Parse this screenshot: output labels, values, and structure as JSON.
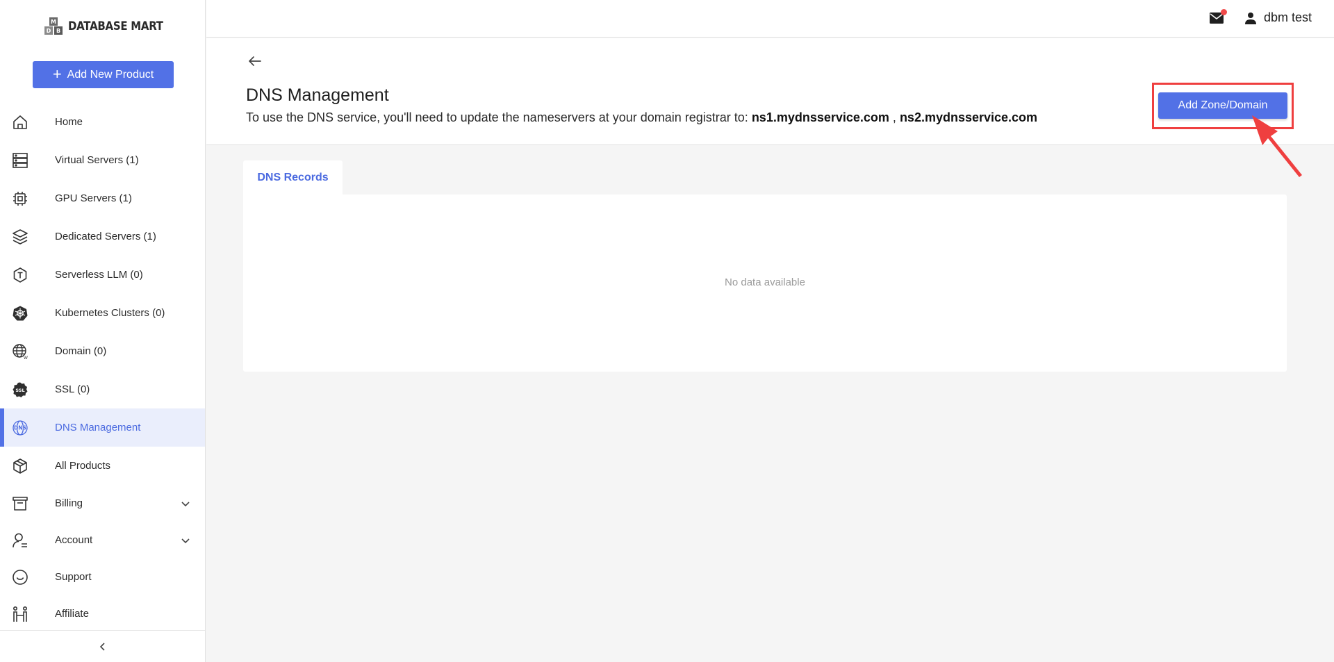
{
  "brand": {
    "name": "DATABASE MART"
  },
  "sidebar": {
    "add_button": "Add New Product",
    "items": [
      {
        "label": "Home",
        "icon": "home-icon"
      },
      {
        "label": "Virtual Servers (1)",
        "icon": "virtual-servers-icon"
      },
      {
        "label": "GPU Servers (1)",
        "icon": "gpu-chip-icon"
      },
      {
        "label": "Dedicated Servers (1)",
        "icon": "dedicated-servers-icon"
      },
      {
        "label": "Serverless LLM (0)",
        "icon": "serverless-llm-icon"
      },
      {
        "label": "Kubernetes Clusters (0)",
        "icon": "kubernetes-icon"
      },
      {
        "label": "Domain (0)",
        "icon": "globe-icon"
      },
      {
        "label": "SSL (0)",
        "icon": "ssl-badge-icon"
      },
      {
        "label": "DNS Management",
        "icon": "dns-icon",
        "active": true
      },
      {
        "label": "All Products",
        "icon": "box-icon"
      },
      {
        "label": "Billing",
        "icon": "billing-icon",
        "expandable": true
      },
      {
        "label": "Account",
        "icon": "account-icon",
        "expandable": true
      },
      {
        "label": "Support",
        "icon": "support-icon"
      },
      {
        "label": "Affiliate",
        "icon": "affiliate-icon"
      }
    ]
  },
  "topbar": {
    "user_name": "dbm test",
    "has_unread_mail": true
  },
  "header": {
    "title": "DNS Management",
    "subtitle_prefix": "To use the DNS service, you'll need to update the nameservers at your domain registrar to: ",
    "ns1": "ns1.mydnsservice.com",
    "separator": " , ",
    "ns2": "ns2.mydnsservice.com",
    "add_zone_button": "Add Zone/Domain"
  },
  "tabs": [
    {
      "label": "DNS Records",
      "active": true
    }
  ],
  "records": {
    "empty_text": "No data available"
  },
  "colors": {
    "accent": "#5271e6",
    "highlight": "#ef3f3f",
    "active_bg": "#eaeefc"
  }
}
